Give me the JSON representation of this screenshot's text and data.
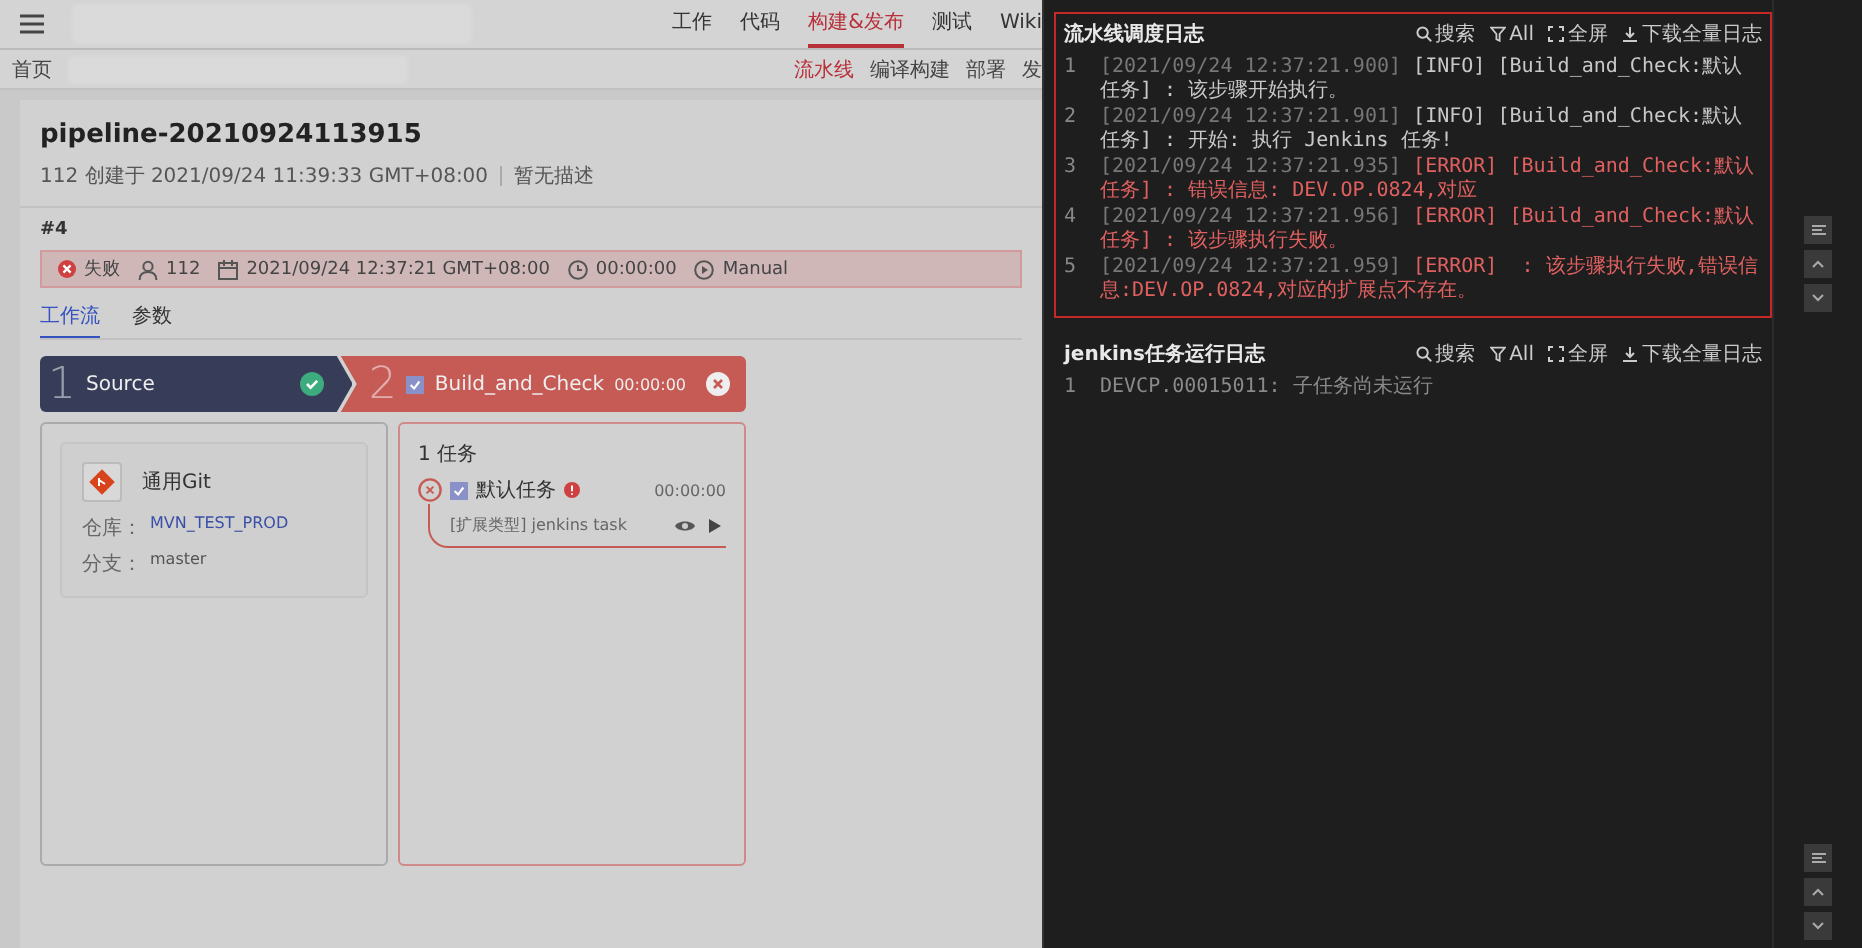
{
  "nav": {
    "items": [
      {
        "label": "工作",
        "selected": false
      },
      {
        "label": "代码",
        "selected": false
      },
      {
        "label": "构建&发布",
        "selected": true
      },
      {
        "label": "测试",
        "selected": false
      },
      {
        "label": "Wiki",
        "selected": false
      }
    ]
  },
  "subnav": {
    "home": "首页",
    "items": [
      {
        "label": "流水线",
        "selected": true
      },
      {
        "label": "编译构建",
        "selected": false
      },
      {
        "label": "部署",
        "selected": false
      },
      {
        "label": "发",
        "selected": false
      }
    ]
  },
  "pipeline": {
    "title": "pipeline-20210924113915",
    "meta": "112 创建于 2021/09/24 11:39:33 GMT+08:00",
    "description": "暂无描述",
    "run_number": "#4",
    "run": {
      "status": "失败",
      "user": "112",
      "date": "2021/09/24 12:37:21 GMT+08:00",
      "duration": "00:00:00",
      "trigger": "Manual"
    }
  },
  "tabs": [
    {
      "label": "工作流",
      "selected": true
    },
    {
      "label": "参数",
      "selected": false
    }
  ],
  "stages": [
    {
      "number": "1",
      "name": "Source",
      "failed": false
    },
    {
      "number": "2",
      "name": "Build_and_Check",
      "failed": true,
      "checked": true,
      "duration": "00:00:00"
    }
  ],
  "source_card": {
    "name": "通用Git",
    "fields": [
      {
        "label": "仓库：",
        "value": "MVN_TEST_PROD",
        "link": true
      },
      {
        "label": "分支：",
        "value": "master",
        "link": false
      }
    ]
  },
  "build_card": {
    "count": "1 任务",
    "tasks": [
      {
        "name": "默认任务",
        "checked": true,
        "failed": true,
        "warning": true,
        "duration": "00:00:00",
        "type": "[扩展类型] jenkins task"
      }
    ]
  },
  "logs": [
    {
      "title": "流水线调度日志",
      "highlighted": true,
      "tools": [
        {
          "kind": "search",
          "label": "搜索"
        },
        {
          "kind": "filter",
          "label": "All"
        },
        {
          "kind": "fullscreen",
          "label": "全屏"
        },
        {
          "kind": "download",
          "label": "下载全量日志"
        }
      ],
      "lines": [
        {
          "number": "1",
          "kind": "info",
          "time": "[2021/09/24 12:37:21.900]",
          "tag": "[INFO]",
          "message": "[Build_and_Check:默认任务] : 该步骤开始执行。"
        },
        {
          "number": "2",
          "kind": "info",
          "time": "[2021/09/24 12:37:21.901]",
          "tag": "[INFO]",
          "message": "[Build_and_Check:默认任务] : 开始: 执行 Jenkins 任务!"
        },
        {
          "number": "3",
          "kind": "error",
          "time": "[2021/09/24 12:37:21.935]",
          "tag": "[ERROR]",
          "message": "[Build_and_Check:默认任务] : 错误信息: DEV.OP.0824,对应"
        },
        {
          "number": "4",
          "kind": "error",
          "time": "[2021/09/24 12:37:21.956]",
          "tag": "[ERROR]",
          "message": "[Build_and_Check:默认任务] : 该步骤执行失败。"
        },
        {
          "number": "5",
          "kind": "error",
          "time": "[2021/09/24 12:37:21.959]",
          "tag": "[ERROR]",
          "message": " : 该步骤执行失败,错误信息:DEV.OP.0824,对应的扩展点不存在。"
        }
      ]
    },
    {
      "title": "jenkins任务运行日志",
      "highlighted": false,
      "tools": [
        {
          "kind": "search",
          "label": "搜索"
        },
        {
          "kind": "filter",
          "label": "All"
        },
        {
          "kind": "fullscreen",
          "label": "全屏"
        },
        {
          "kind": "download",
          "label": "下载全量日志"
        }
      ],
      "lines": [
        {
          "number": "1",
          "kind": "plain",
          "message": "DEVCP.00015011: 子任务尚未运行"
        }
      ]
    }
  ]
}
